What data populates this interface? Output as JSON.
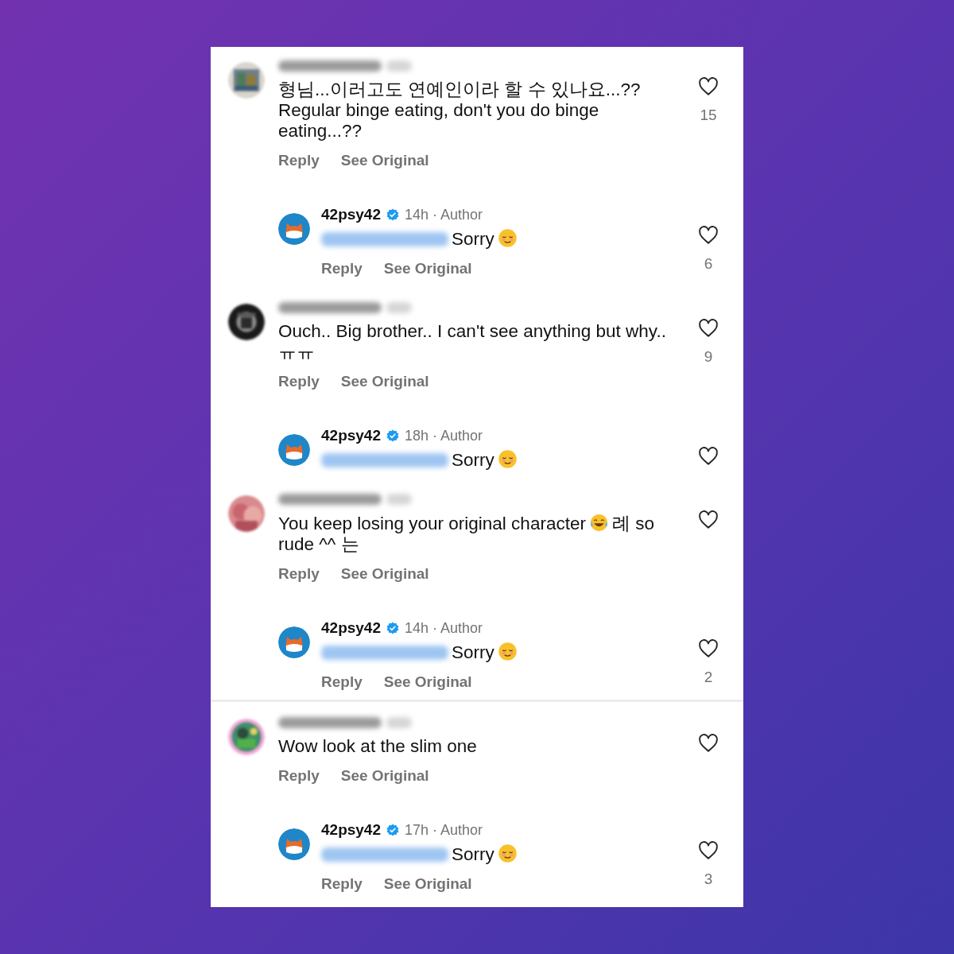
{
  "comments": [
    {
      "kind": "comment",
      "body": [
        {
          "kind": "text",
          "text": "형님...이러고도 연예인이라 할 수 있나요...??"
        },
        {
          "kind": "line",
          "text": "Regular binge eating, don't you do binge eating...??"
        }
      ],
      "actions": [
        "Reply",
        "See Original"
      ],
      "likes": "15"
    },
    {
      "kind": "reply",
      "author": "42psy42",
      "verified": true,
      "meta": "14h · Author",
      "body": [
        {
          "kind": "text",
          "text": "Sorry"
        },
        {
          "kind": "smiling_emoji"
        }
      ],
      "actions": [
        "Reply",
        "See Original"
      ],
      "likes": "6",
      "divider_after": false
    },
    {
      "kind": "comment",
      "body": [
        {
          "kind": "text",
          "text": "Ouch.. Big brother.. I can't see anything but why.."
        },
        {
          "kind": "line",
          "text": "ㅠㅠ"
        }
      ],
      "actions": [
        "Reply",
        "See Original"
      ],
      "likes": "9"
    },
    {
      "kind": "reply",
      "author": "42psy42",
      "verified": true,
      "meta": "18h · Author",
      "body": [
        {
          "kind": "text",
          "text": "Sorry"
        },
        {
          "kind": "smiling_emoji"
        }
      ],
      "divider_after": false
    },
    {
      "kind": "comment",
      "body": [
        {
          "kind": "text",
          "text": "You keep losing your original character"
        },
        {
          "kind": "laughing_emoji"
        },
        {
          "kind": "text",
          "text": "례 so"
        },
        {
          "kind": "line",
          "text": "rude ^^ 는"
        }
      ],
      "actions": [
        "Reply",
        "See Original"
      ]
    },
    {
      "kind": "reply",
      "author": "42psy42",
      "verified": true,
      "meta": "14h · Author",
      "body": [
        {
          "kind": "text",
          "text": "Sorry"
        },
        {
          "kind": "smiling_emoji"
        }
      ],
      "actions": [
        "Reply",
        "See Original"
      ],
      "likes": "2",
      "divider_after": true
    },
    {
      "kind": "comment",
      "body": [
        {
          "kind": "text",
          "text": "Wow look at the slim one"
        }
      ],
      "actions": [
        "Reply",
        "See Original"
      ]
    },
    {
      "kind": "reply",
      "author": "42psy42",
      "verified": true,
      "meta": "17h · Author",
      "body": [
        {
          "kind": "text",
          "text": "Sorry"
        },
        {
          "kind": "smiling_emoji"
        }
      ],
      "actions": [
        "Reply",
        "See Original"
      ],
      "likes": "3",
      "divider_after": false
    }
  ]
}
